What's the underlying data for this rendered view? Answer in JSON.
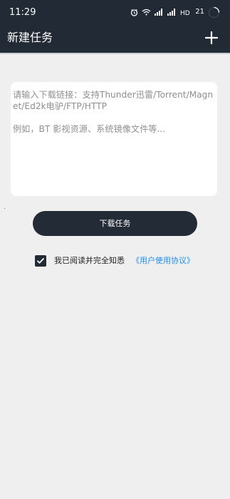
{
  "status_bar": {
    "time": "11:29",
    "battery": "21"
  },
  "header": {
    "title": "新建任务",
    "add_icon": "plus-icon"
  },
  "input": {
    "placeholder": "请输入下载链接：支持Thunder迅雷/Torrent/Magnet/Ed2k电驴/FTP/HTTP\n\n例如，BT 影视资源、系统镜像文件等..."
  },
  "action": {
    "download_label": "下载任务"
  },
  "agreement": {
    "checked": true,
    "text": "我已阅读并完全知悉",
    "link": "《用户使用协议》"
  },
  "colors": {
    "header": "#222a35",
    "background": "#efefef",
    "link": "#1e8ef2"
  }
}
